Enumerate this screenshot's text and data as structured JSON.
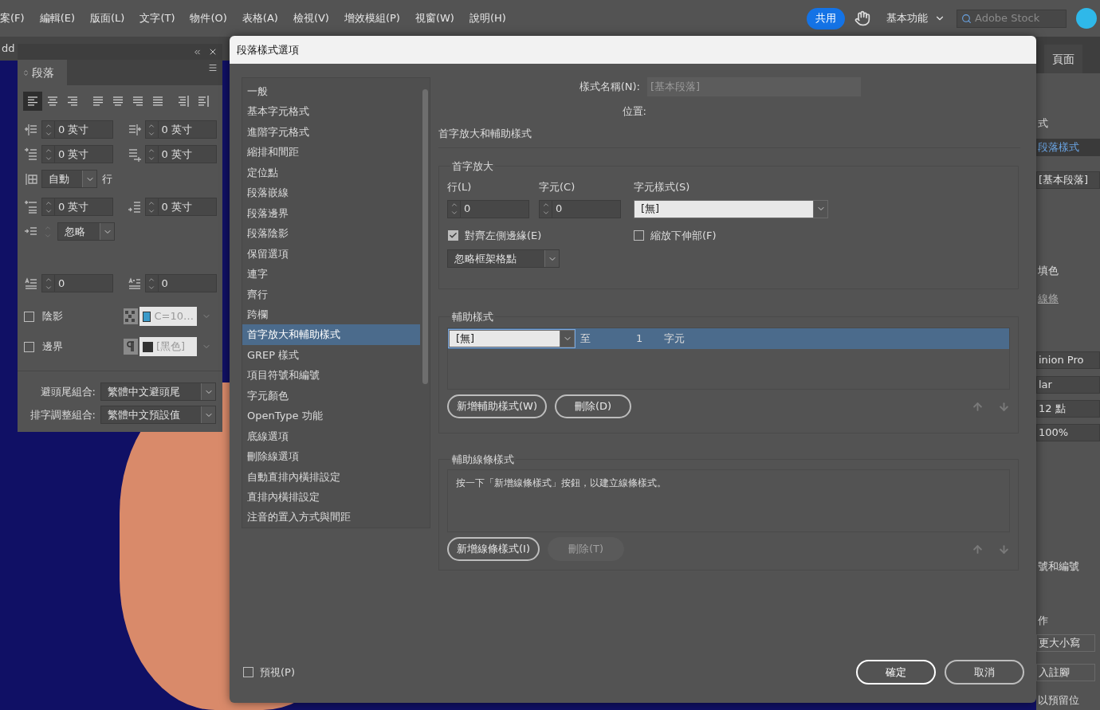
{
  "menu_bar": {
    "items": [
      "案(F)",
      "編輯(E)",
      "版面(L)",
      "文字(T)",
      "物件(O)",
      "表格(A)",
      "檢視(V)",
      "增效模組(P)",
      "視窗(W)",
      "說明(H)"
    ],
    "share": "共用",
    "workspace": "基本功能",
    "search_placeholder": "Adobe Stock"
  },
  "document_tab": "dd",
  "paragraph_panel": {
    "tab": "段落",
    "alignments": [
      {
        "kind": "left",
        "selected": true
      },
      {
        "kind": "center",
        "selected": false
      },
      {
        "kind": "right",
        "selected": false
      },
      {
        "kind": "justify-left",
        "selected": false
      },
      {
        "kind": "justify-center",
        "selected": false
      },
      {
        "kind": "justify-right",
        "selected": false
      },
      {
        "kind": "justify-all",
        "selected": false
      },
      {
        "kind": "toward-spine",
        "selected": false
      },
      {
        "kind": "away-spine",
        "selected": false
      }
    ],
    "indent_fields": [
      {
        "kind": "left-indent",
        "value": "0 英寸"
      },
      {
        "kind": "right-indent",
        "value": "0 英寸"
      },
      {
        "kind": "first-line",
        "value": "0 英寸"
      },
      {
        "kind": "last-line",
        "value": "0 英寸"
      }
    ],
    "grid": {
      "value": "自動",
      "unit": "行"
    },
    "space_fields": [
      {
        "kind": "space-before",
        "value": "0 英寸"
      },
      {
        "kind": "space-after",
        "value": "0 英寸"
      }
    ],
    "align_grid": {
      "value": "忽略"
    },
    "drop_fields": [
      {
        "kind": "drop-lines",
        "value": "0"
      },
      {
        "kind": "drop-chars",
        "value": "0"
      }
    ],
    "swatch_rows": [
      {
        "label": "陰影",
        "checked": false,
        "kind": "shading",
        "swatch": "C=10…",
        "color": "#3a9ac9"
      },
      {
        "label": "邊界",
        "checked": false,
        "kind": "border",
        "swatch": "[黑色]",
        "color": "#333333"
      }
    ],
    "combos": [
      {
        "label": "避頭尾組合:",
        "value": "繁體中文避頭尾"
      },
      {
        "label": "排字調整組合:",
        "value": "繁體中文預設值"
      }
    ]
  },
  "right_panel": {
    "tab": "頁面",
    "items": [
      {
        "kind": "label",
        "text": "式"
      },
      {
        "kind": "link",
        "text": "段落樣式"
      },
      {
        "kind": "field",
        "text": "[基本段落]"
      },
      {
        "kind": "label",
        "text": "填色"
      },
      {
        "kind": "underline",
        "text": "線條"
      },
      {
        "kind": "field",
        "text": "inion Pro"
      },
      {
        "kind": "field",
        "text": "lar"
      },
      {
        "kind": "field",
        "text": "12 點"
      },
      {
        "kind": "field",
        "text": "100%"
      },
      {
        "kind": "label",
        "text": "號和編號"
      },
      {
        "kind": "label",
        "text": "作"
      },
      {
        "kind": "button",
        "text": "更大小寫"
      },
      {
        "kind": "button",
        "text": "入註腳"
      },
      {
        "kind": "label",
        "text": "以預留位"
      }
    ]
  },
  "dialog": {
    "title": "段落樣式選項",
    "categories": [
      {
        "label": "一般",
        "selected": false
      },
      {
        "label": "基本字元格式",
        "selected": false
      },
      {
        "label": "進階字元格式",
        "selected": false
      },
      {
        "label": "縮排和間距",
        "selected": false
      },
      {
        "label": "定位點",
        "selected": false
      },
      {
        "label": "段落嵌線",
        "selected": false
      },
      {
        "label": "段落邊界",
        "selected": false
      },
      {
        "label": "段落陰影",
        "selected": false
      },
      {
        "label": "保留選項",
        "selected": false
      },
      {
        "label": "連字",
        "selected": false
      },
      {
        "label": "齊行",
        "selected": false
      },
      {
        "label": "跨欄",
        "selected": false
      },
      {
        "label": "首字放大和輔助樣式",
        "selected": true
      },
      {
        "label": "GREP 樣式",
        "selected": false
      },
      {
        "label": "項目符號和編號",
        "selected": false
      },
      {
        "label": "字元顏色",
        "selected": false
      },
      {
        "label": "OpenType 功能",
        "selected": false
      },
      {
        "label": "底線選項",
        "selected": false
      },
      {
        "label": "刪除線選項",
        "selected": false
      },
      {
        "label": "自動直排內橫排設定",
        "selected": false
      },
      {
        "label": "直排內橫排設定",
        "selected": false
      },
      {
        "label": "注音的置入方式與間距",
        "selected": false
      }
    ],
    "style_name": {
      "label": "樣式名稱(N):",
      "value": "[基本段落]"
    },
    "location": {
      "label": "位置:"
    },
    "section_title": "首字放大和輔助樣式",
    "drop_caps": {
      "title": "首字放大",
      "lines": {
        "label": "行(L)",
        "value": "0"
      },
      "characters": {
        "label": "字元(C)",
        "value": "0"
      },
      "character_style": {
        "label": "字元樣式(S)",
        "value": "[無]"
      },
      "align_left_edge": {
        "label": "對齊左側邊緣(E)",
        "checked": true
      },
      "scale_descenders": {
        "label": "縮放下伸部(F)",
        "checked": false
      },
      "grid_option": "忽略框架格點"
    },
    "nested_styles": {
      "title": "輔助樣式",
      "rows": [
        {
          "style": "[無]",
          "through": "至",
          "count": "1",
          "unit": "字元",
          "selected": true
        }
      ],
      "buttons": [
        {
          "label": "新增輔助樣式(W)",
          "disabled": false
        },
        {
          "label": "刪除(D)",
          "disabled": false
        }
      ]
    },
    "nested_line_styles": {
      "title": "輔助線條樣式",
      "hint": "按一下「新增線條樣式」按鈕，以建立線條樣式。",
      "buttons": [
        {
          "label": "新增線條樣式(I)",
          "disabled": false
        },
        {
          "label": "刪除(T)",
          "disabled": true
        }
      ]
    },
    "preview": {
      "label": "預視(P)",
      "checked": false
    },
    "ok": "確定",
    "cancel": "取消"
  }
}
